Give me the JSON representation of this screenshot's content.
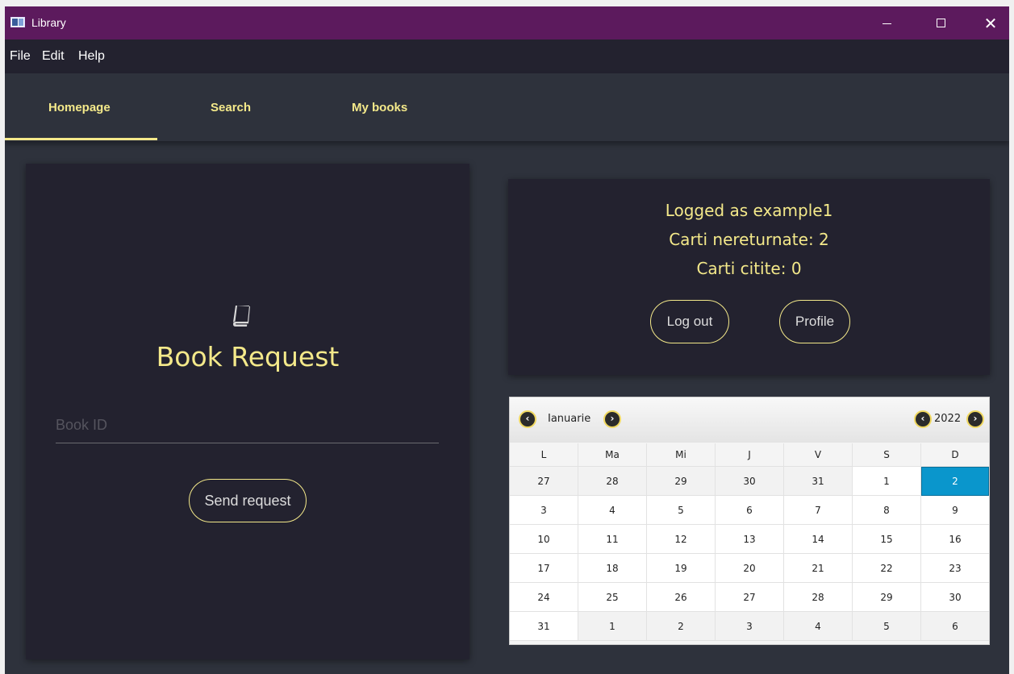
{
  "window": {
    "title": "Library"
  },
  "menu": {
    "items": [
      "File",
      "Edit",
      "Help"
    ]
  },
  "tabs": [
    "Homepage",
    "Search",
    "My books"
  ],
  "book_request": {
    "title": "Book Request",
    "input_placeholder": "Book ID",
    "send_label": "Send request"
  },
  "user_info": {
    "logged_as": "Logged as example1",
    "unreturned": "Carti nereturnate: 2",
    "read": "Carti citite: 0",
    "logout_label": "Log out",
    "profile_label": "Profile"
  },
  "calendar": {
    "month": "Ianuarie",
    "year": "2022",
    "weekdays": [
      "L",
      "Ma",
      "Mi",
      "J",
      "V",
      "S",
      "D"
    ],
    "weeks": [
      [
        "27",
        "28",
        "29",
        "30",
        "31",
        "1",
        "2"
      ],
      [
        "3",
        "4",
        "5",
        "6",
        "7",
        "8",
        "9"
      ],
      [
        "10",
        "11",
        "12",
        "13",
        "14",
        "15",
        "16"
      ],
      [
        "17",
        "18",
        "19",
        "20",
        "21",
        "22",
        "23"
      ],
      [
        "24",
        "25",
        "26",
        "27",
        "28",
        "29",
        "30"
      ],
      [
        "31",
        "1",
        "2",
        "3",
        "4",
        "5",
        "6"
      ]
    ],
    "selected_day": "2",
    "colors": {
      "selected": "#0a96cc",
      "nav_ring": "#f0d860"
    }
  },
  "colors": {
    "accent": "#f4e98a",
    "titlebar": "#5c1a5d",
    "panel": "#23222f",
    "background": "#2e323c"
  }
}
